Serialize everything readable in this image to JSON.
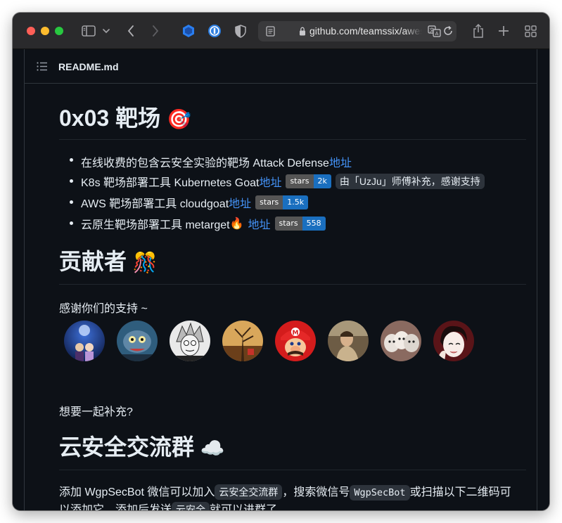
{
  "browser": {
    "url": "github.com/teamssix/awesome-cloud-security"
  },
  "readme": {
    "filename": "README.md"
  },
  "section_range": {
    "heading": "0x03 靶场",
    "emoji": "🎯",
    "items": [
      {
        "text": "在线收费的包含云安全实验的靶场 Attack Defense ",
        "link": "地址"
      },
      {
        "text": "K8s 靶场部署工具 Kubernetes Goat ",
        "link": "地址",
        "badge_label": "stars",
        "badge_value": "2k",
        "note": "由「UzJu」师傅补充，感谢支持"
      },
      {
        "text": "AWS 靶场部署工具 cloudgoat ",
        "link": "地址",
        "badge_label": "stars",
        "badge_value": "1.5k"
      },
      {
        "text": "云原生靶场部署工具 metarget ",
        "emoji": "🔥",
        "link": "地址",
        "badge_label": "stars",
        "badge_value": "558"
      }
    ]
  },
  "section_contributors": {
    "heading": "贡献者",
    "emoji": "🎊",
    "thanks": "感谢你们的支持 ~",
    "avatar_count": 8,
    "join_link": "想要一起补充?"
  },
  "section_group": {
    "heading": "云安全交流群",
    "emoji": "☁️",
    "p_a": "添加 WgpSecBot 微信可以加入",
    "code_a": "云安全交流群",
    "p_b": "，搜索微信号",
    "code_b": "WgpSecBot",
    "p_c": "或扫描以下二维码可",
    "p_d": "以添加它，添加后发送",
    "code_c": "云安全",
    "p_e": "就可以进群了。"
  },
  "colors": {
    "background": "#0d1117",
    "text": "#e6edf3",
    "link": "#4493f8",
    "badge_value": "#1a6fbf",
    "toolbar": "#2a2a2c"
  }
}
